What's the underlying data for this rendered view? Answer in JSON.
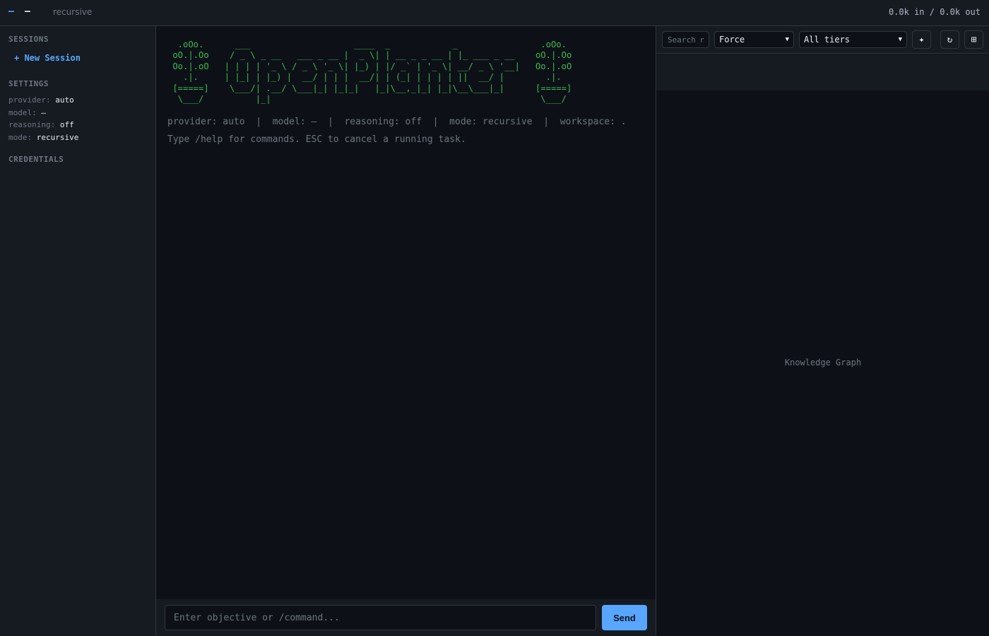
{
  "topbar": {
    "dash_left": "–",
    "dash_right": "–",
    "mode_label": "recursive",
    "tokens": "0.0k in / 0.0k out"
  },
  "sidebar": {
    "sessions_header": "SESSIONS",
    "new_session_label": "+ New Session",
    "settings_header": "SETTINGS",
    "settings": [
      {
        "key": "provider:",
        "value": "auto"
      },
      {
        "key": "model:",
        "value": "–"
      },
      {
        "key": "reasoning:",
        "value": "off"
      },
      {
        "key": "mode:",
        "value": "recursive"
      }
    ],
    "credentials_header": "CREDENTIALS"
  },
  "main": {
    "banner_ascii": "  .oOo.      ___                    ____  _            _                .oOo.\n oO.|.Oo    / _ \\ _ __   ___ _ __ |  _ \\| | __ _ _ __ | |_ ___ _ __    oO.|.Oo\n Oo.|.oO   | | | | '_ \\ / _ \\ '_ \\| |_) | |/ _` | '_ \\| __/ _ \\ '__|   Oo.|.oO\n   .|.     | |_| | |_) |  __/ | | |  __/| | (_| | | | | ||  __/ |        .|.\n [=====]    \\___/| .__/ \\___|_| |_|_|   |_|\\__,_|_| |_|\\__\\___|_|      [=====]\n  \\___/          |_|                                                    \\___/",
    "status_line": "provider: auto  |  model: –  |  reasoning: off  |  mode: recursive  |  workspace: .",
    "hint_line": "Type /help for commands. ESC to cancel a running task.",
    "input_placeholder": "Enter objective or /command...",
    "send_label": "Send"
  },
  "graph": {
    "search_placeholder": "Search nodes",
    "layout_select": "Force",
    "tier_select": "All tiers",
    "sparkle_icon": "✦",
    "refresh_icon": "↻",
    "grid_icon": "⊞",
    "placeholder": "Knowledge Graph"
  }
}
